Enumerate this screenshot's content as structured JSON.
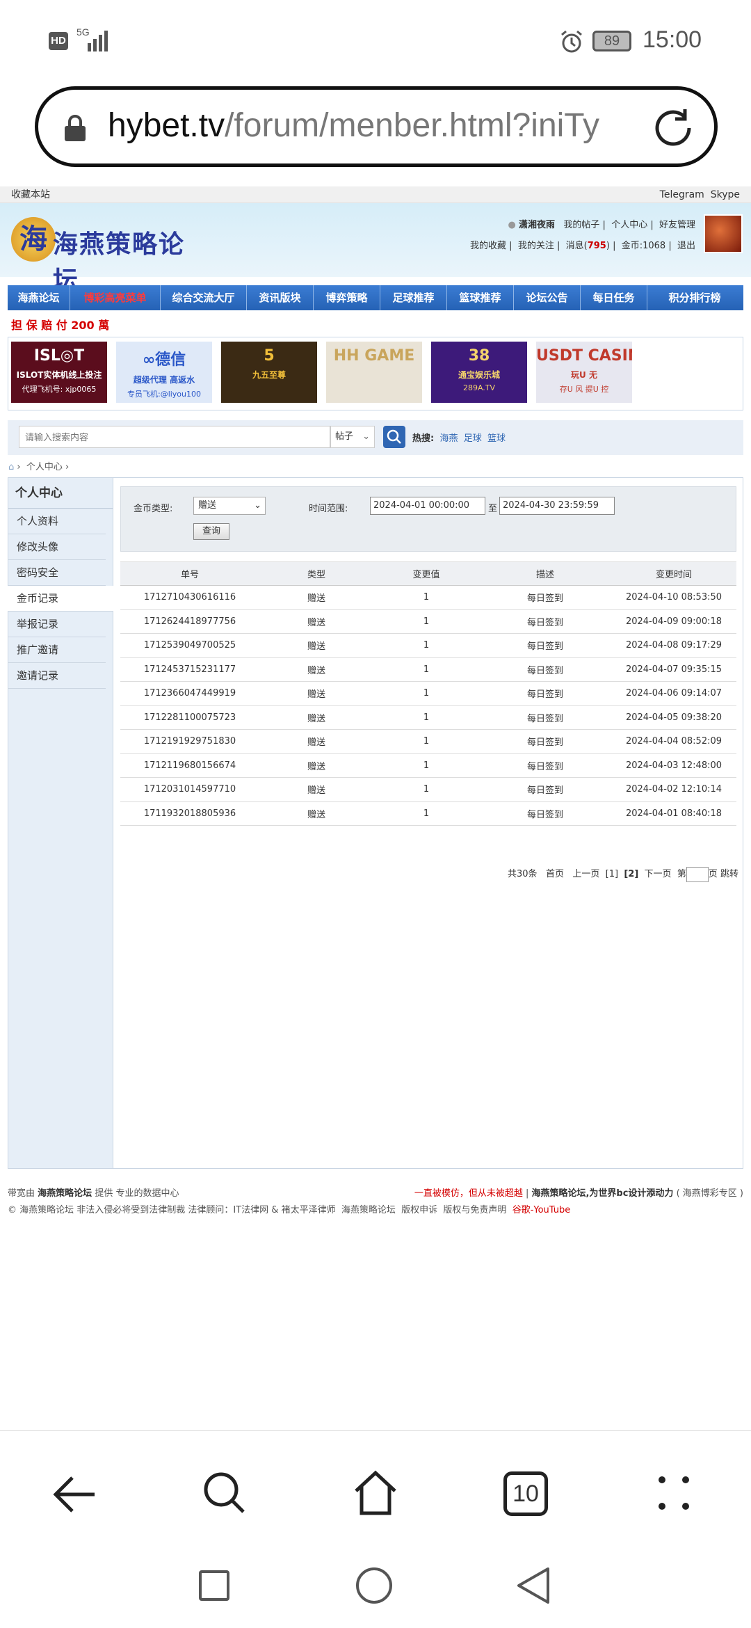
{
  "status": {
    "signal": "5G",
    "hd": "HD",
    "battery": "89",
    "time": "15:00"
  },
  "browser": {
    "url_domain": "hybet.tv",
    "url_path": "/forum/menber.html?iniTy",
    "tabs_count": "10"
  },
  "topbar": {
    "bookmark": "收藏本站",
    "links": [
      "Telegram",
      "Skype"
    ]
  },
  "header": {
    "logo_text": "海燕策略论坛",
    "logo_glyph": "海",
    "username": "潇湘夜雨",
    "links_row1": [
      "我的帖子",
      "个人中心",
      "好友管理"
    ],
    "links_row2": [
      "我的收藏",
      "我的关注"
    ],
    "msg_label": "消息",
    "msg_count": "795",
    "coin_label": "金币:",
    "coin_value": "1068",
    "logout": "退出"
  },
  "nav": {
    "items": [
      "海燕论坛",
      "博彩高亮菜单",
      "综合交流大厅",
      "资讯版块",
      "博弈策略",
      "足球推荐",
      "篮球推荐",
      "论坛公告",
      "每日任务",
      "积分排行榜"
    ]
  },
  "guarantee": "担 保 赔 付 200 萬",
  "ads": [
    {
      "title": "ISL◎T",
      "line1": "ISLOT实体机线上投注",
      "line2": "代理飞机号: xjp0065",
      "bg": "#5b0d1d",
      "fg": "#fff"
    },
    {
      "title": "∞德信",
      "line1": "超级代理 高返水",
      "line2": "专员飞机:@liyou100",
      "bg": "#dfe9f8",
      "fg": "#2a57c8"
    },
    {
      "title": "5",
      "line1": "九五至尊",
      "line2": "",
      "bg": "#3b2a14",
      "fg": "#f3c03a"
    },
    {
      "title": "HH GAME",
      "line1": "",
      "line2": "",
      "bg": "#e9e3d6",
      "fg": "#c9a55c"
    },
    {
      "title": "38",
      "line1": "通宝娱乐城",
      "line2": "289A.TV",
      "bg": "#3d1a7a",
      "fg": "#f4d36b"
    },
    {
      "title": "USDT CASINO",
      "line1": "玩U 无",
      "line2": "存U 风 提U 控",
      "bg": "#e7e7f0",
      "fg": "#c0392b"
    }
  ],
  "search": {
    "placeholder": "请输入搜索内容",
    "select": "帖子",
    "hot_label": "热搜:",
    "hot": [
      "海燕",
      "足球",
      "篮球"
    ]
  },
  "breadcrumb": {
    "item": "个人中心"
  },
  "sidebar": {
    "title": "个人中心",
    "items": [
      "个人资料",
      "修改头像",
      "密码安全",
      "金币记录",
      "举报记录",
      "推广邀请",
      "邀请记录"
    ],
    "active": 3
  },
  "filter": {
    "type_label": "金币类型:",
    "type_value": "赠送",
    "range_label": "时间范围:",
    "from": "2024-04-01 00:00:00",
    "to_label": "至",
    "to": "2024-04-30 23:59:59",
    "query_button": "查询"
  },
  "table": {
    "headers": [
      "单号",
      "类型",
      "变更值",
      "描述",
      "变更时间"
    ],
    "rows": [
      [
        "1712710430616116",
        "赠送",
        "1",
        "每日签到",
        "2024-04-10 08:53:50"
      ],
      [
        "1712624418977756",
        "赠送",
        "1",
        "每日签到",
        "2024-04-09 09:00:18"
      ],
      [
        "1712539049700525",
        "赠送",
        "1",
        "每日签到",
        "2024-04-08 09:17:29"
      ],
      [
        "1712453715231177",
        "赠送",
        "1",
        "每日签到",
        "2024-04-07 09:35:15"
      ],
      [
        "1712366047449919",
        "赠送",
        "1",
        "每日签到",
        "2024-04-06 09:14:07"
      ],
      [
        "1712281100075723",
        "赠送",
        "1",
        "每日签到",
        "2024-04-05 09:38:20"
      ],
      [
        "1712191929751830",
        "赠送",
        "1",
        "每日签到",
        "2024-04-04 08:52:09"
      ],
      [
        "1712119680156674",
        "赠送",
        "1",
        "每日签到",
        "2024-04-03 12:48:00"
      ],
      [
        "1712031014597710",
        "赠送",
        "1",
        "每日签到",
        "2024-04-02 12:10:14"
      ],
      [
        "1711932018805936",
        "赠送",
        "1",
        "每日签到",
        "2024-04-01 08:40:18"
      ]
    ]
  },
  "pager": {
    "total": "共30条",
    "first": "首页",
    "prev": "上一页",
    "p1": "[1]",
    "p2": "[2]",
    "next": "下一页",
    "go_prefix": "第",
    "go_suffix": "页",
    "jump": "跳转"
  },
  "footer": {
    "l1_prefix": "带宽由",
    "l1_brand": "海燕策略论坛",
    "l1_suffix": "提供 专业的数据中心",
    "r1_red": "一直被模仿，但从未被超越",
    "r1_brand": "海燕策略论坛,为世界bc设计添动力",
    "r1_zone": "( 海燕博彩专区 )",
    "l2": "© 海燕策略论坛 非法入侵必将受到法律制裁 法律顾问：IT法律网 & 褚太平泽律师",
    "l2_links": [
      "海燕策略论坛",
      "版权申诉",
      "版权与免责声明"
    ],
    "l2_red": "谷歌-YouTube"
  }
}
